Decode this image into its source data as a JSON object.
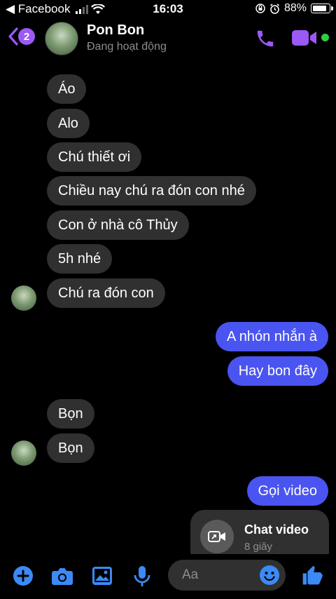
{
  "status_bar": {
    "back_app": "◀ Facebook",
    "time": "16:03",
    "battery_pct": "88%"
  },
  "header": {
    "unread_count": "2",
    "contact_name": "Pon Bon",
    "contact_status": "Đang hoạt động"
  },
  "messages": [
    {
      "dir": "in",
      "text": "Áo"
    },
    {
      "dir": "in",
      "text": "Alo"
    },
    {
      "dir": "in",
      "text": "Chú thiết ơi"
    },
    {
      "dir": "in",
      "text": "Chiều nay chú ra đón con nhé"
    },
    {
      "dir": "in",
      "text": "Con ở nhà cô Thủy"
    },
    {
      "dir": "in",
      "text": "5h nhé"
    },
    {
      "dir": "in",
      "text": "Chú ra đón con"
    },
    {
      "dir": "out",
      "text": "A nhón nhắn à"
    },
    {
      "dir": "out",
      "text": "Hay bon đây"
    },
    {
      "dir": "in",
      "text": "Bọn"
    },
    {
      "dir": "in",
      "text": "Bọn"
    },
    {
      "dir": "out",
      "text": "Gọi video"
    }
  ],
  "video_call_card": {
    "title": "Chat video",
    "subtitle": "8 giây"
  },
  "composer": {
    "placeholder": "Aa"
  },
  "colors": {
    "accent": "#9b59f5",
    "outgoing_bubble": "#4a54f0",
    "incoming_bubble": "#303030",
    "composer_icon": "#3b8af5",
    "online": "#31cc46"
  }
}
